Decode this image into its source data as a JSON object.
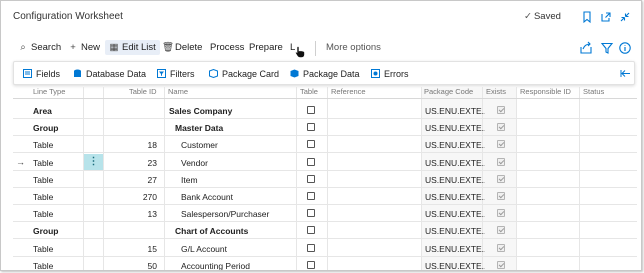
{
  "window": {
    "title": "Configuration Worksheet",
    "saved_label": "Saved"
  },
  "actions": {
    "search": "Search",
    "new": "New",
    "edit_list": "Edit List",
    "delete": "Delete",
    "process": "Process",
    "prepare": "Prepare",
    "partial": "L",
    "more_options": "More options"
  },
  "factbox": {
    "fields": "Fields",
    "database_data": "Database Data",
    "filters": "Filters",
    "package_card": "Package Card",
    "package_data": "Package Data",
    "errors": "Errors"
  },
  "columns": [
    "Line Type",
    "Table ID",
    "Name",
    "Table",
    "Reference",
    "Package Code",
    "Exists",
    "Responsible ID",
    "Status"
  ],
  "rows": [
    {
      "line_type": "Area",
      "table_id": "",
      "name": "Sales Company",
      "indent": 0,
      "bold": true,
      "package_code": "US.ENU.EXTE..."
    },
    {
      "line_type": "Group",
      "table_id": "",
      "name": "Master Data",
      "indent": 1,
      "bold": true,
      "package_code": "US.ENU.EXTE..."
    },
    {
      "line_type": "Table",
      "table_id": "18",
      "name": "Customer",
      "indent": 2,
      "bold": false,
      "package_code": "US.ENU.EXTE..."
    },
    {
      "line_type": "Table",
      "table_id": "23",
      "name": "Vendor",
      "indent": 2,
      "bold": false,
      "package_code": "US.ENU.EXTE..."
    },
    {
      "line_type": "Table",
      "table_id": "27",
      "name": "Item",
      "indent": 2,
      "bold": false,
      "package_code": "US.ENU.EXTE..."
    },
    {
      "line_type": "Table",
      "table_id": "270",
      "name": "Bank Account",
      "indent": 2,
      "bold": false,
      "package_code": "US.ENU.EXTE..."
    },
    {
      "line_type": "Table",
      "table_id": "13",
      "name": "Salesperson/Purchaser",
      "indent": 2,
      "bold": false,
      "package_code": "US.ENU.EXTE..."
    },
    {
      "line_type": "Group",
      "table_id": "",
      "name": "Chart of Accounts",
      "indent": 1,
      "bold": true,
      "package_code": "US.ENU.EXTE..."
    },
    {
      "line_type": "Table",
      "table_id": "15",
      "name": "G/L Account",
      "indent": 2,
      "bold": false,
      "package_code": "US.ENU.EXTE..."
    },
    {
      "line_type": "Table",
      "table_id": "50",
      "name": "Accounting Period",
      "indent": 2,
      "bold": false,
      "package_code": "US.ENU.EXTE..."
    }
  ],
  "colors": {
    "accent": "#0078d4",
    "selected_row_marker": "#b7e3ea"
  }
}
